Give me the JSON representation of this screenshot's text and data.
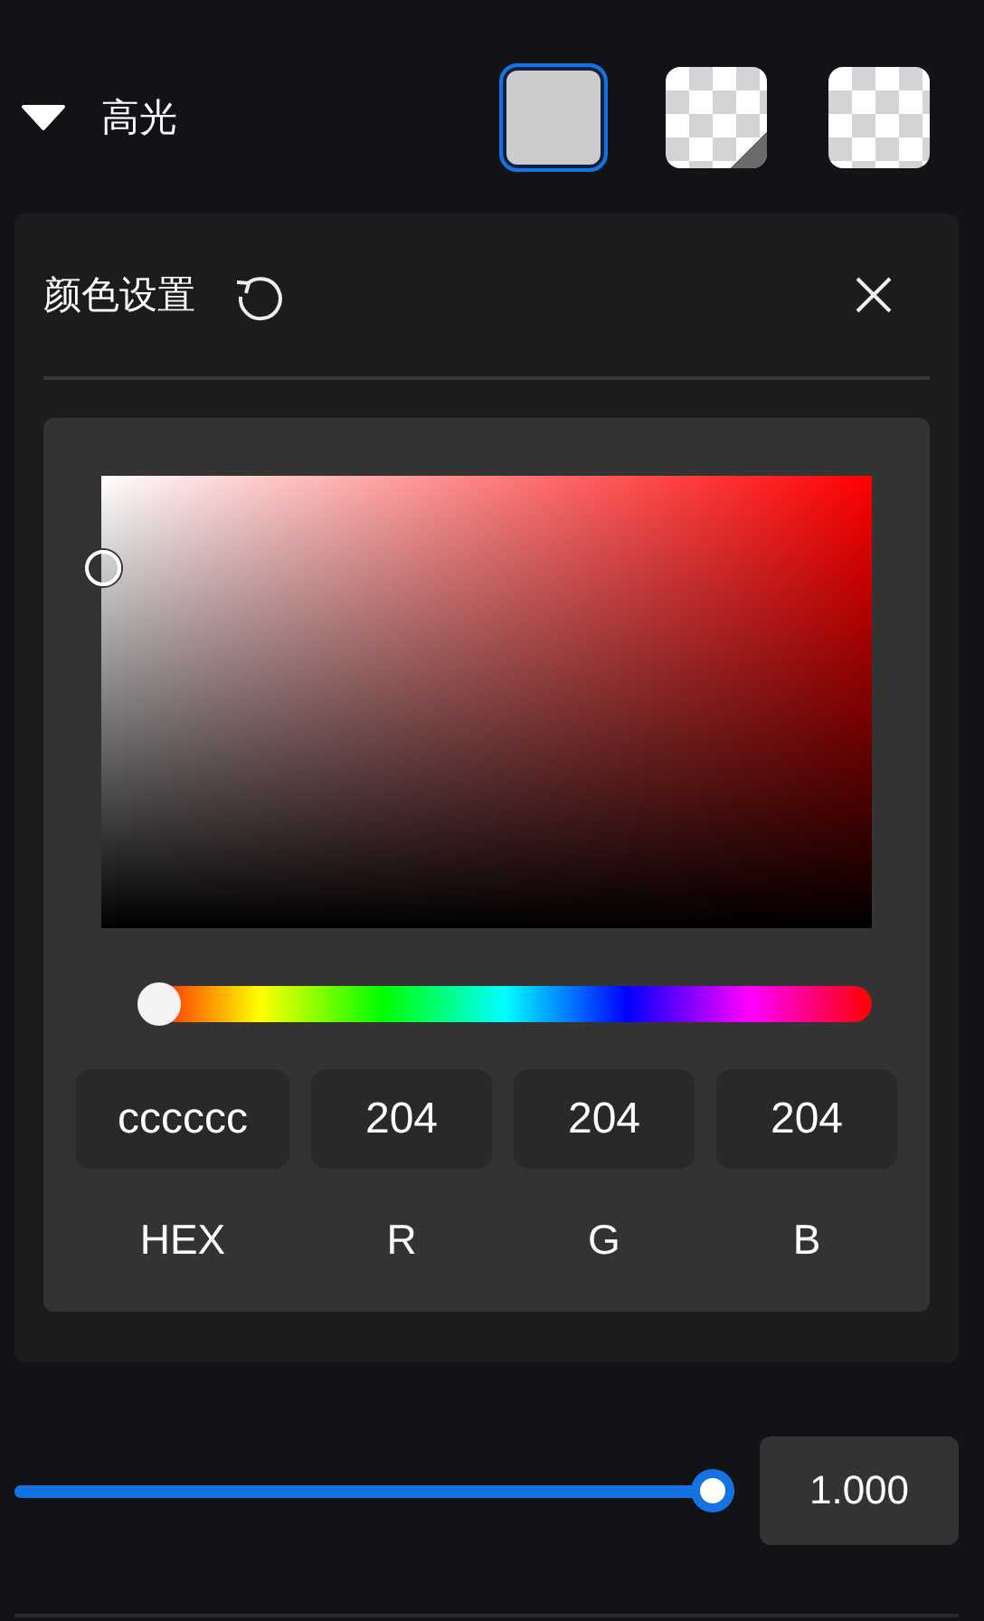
{
  "section": {
    "title": "高光",
    "expanded": true
  },
  "swatches": [
    {
      "kind": "solid",
      "selected": true
    },
    {
      "kind": "checker-fold",
      "selected": false
    },
    {
      "kind": "checker",
      "selected": false
    }
  ],
  "color_panel": {
    "title": "颜色设置",
    "hue_slider": {
      "level": 0
    },
    "fields": [
      {
        "label": "HEX",
        "value": "cccccc"
      },
      {
        "label": "R",
        "value": "204"
      },
      {
        "label": "G",
        "value": "204"
      },
      {
        "label": "B",
        "value": "204"
      }
    ]
  },
  "opacity": {
    "level": 1,
    "value": "1.000"
  }
}
